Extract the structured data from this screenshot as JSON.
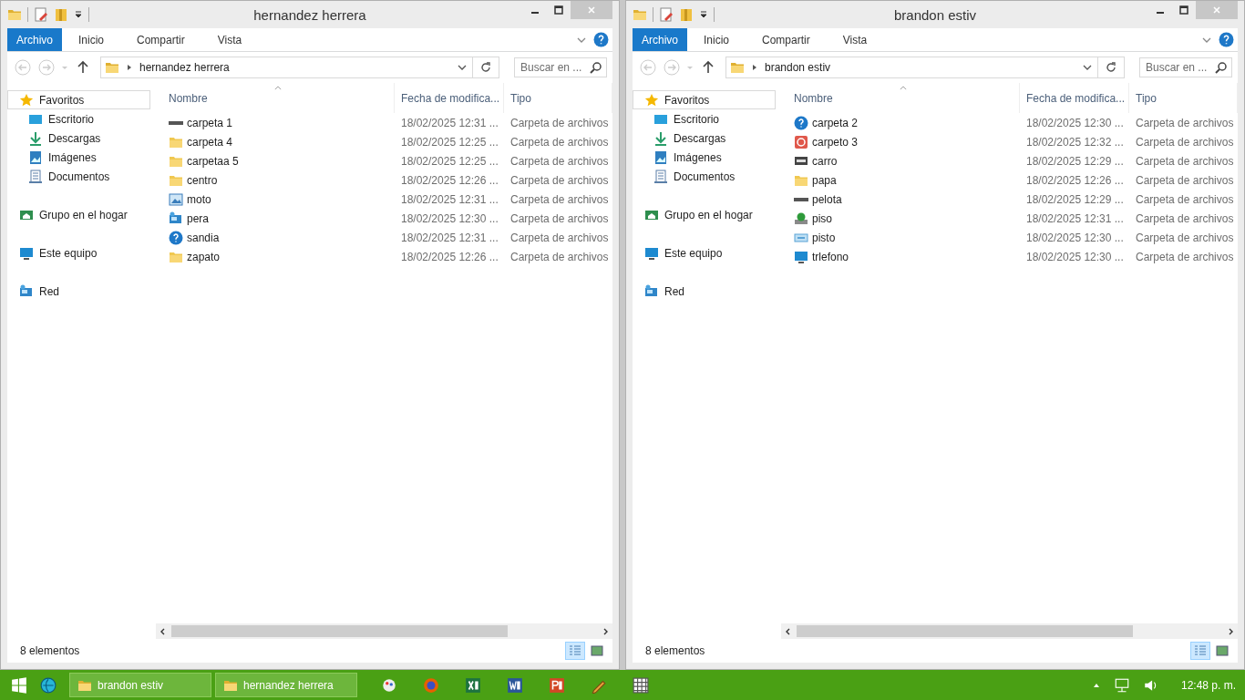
{
  "windows": [
    {
      "title": "hernandez herrera",
      "file_tab": "Archivo",
      "ribbon_tabs": [
        "Inicio",
        "Compartir",
        "Vista"
      ],
      "address": "hernandez herrera",
      "search_placeholder": "Buscar en ...",
      "nav": [
        {
          "label": "Favoritos",
          "kind": "star",
          "selected": true,
          "children": [
            {
              "label": "Escritorio",
              "kind": "desktop",
              "selected": false
            },
            {
              "label": "Descargas",
              "kind": "download",
              "selected": false
            },
            {
              "label": "Imágenes",
              "kind": "pictures",
              "selected": false
            },
            {
              "label": "Documentos",
              "kind": "documents",
              "selected": false
            }
          ]
        },
        {
          "label": "Grupo en el hogar",
          "kind": "homegroup",
          "selected": false
        },
        {
          "label": "Este equipo",
          "kind": "computer",
          "selected": false
        },
        {
          "label": "Red",
          "kind": "network",
          "selected": false
        }
      ],
      "columns": [
        "Nombre",
        "Fecha de modifica...",
        "Tipo"
      ],
      "files": [
        {
          "name": "carpeta 1",
          "kind": "drive",
          "date": "18/02/2025 12:31 ...",
          "type": "Carpeta de archivos"
        },
        {
          "name": "carpeta 4",
          "kind": "folder",
          "date": "18/02/2025 12:25 ...",
          "type": "Carpeta de archivos"
        },
        {
          "name": "carpetaa 5",
          "kind": "folder",
          "date": "18/02/2025 12:25 ...",
          "type": "Carpeta de archivos"
        },
        {
          "name": "centro",
          "kind": "folder",
          "date": "18/02/2025 12:26 ...",
          "type": "Carpeta de archivos"
        },
        {
          "name": "moto",
          "kind": "picture",
          "date": "18/02/2025 12:31 ...",
          "type": "Carpeta de archivos"
        },
        {
          "name": "pera",
          "kind": "network",
          "date": "18/02/2025 12:30 ...",
          "type": "Carpeta de archivos"
        },
        {
          "name": "sandia",
          "kind": "help",
          "date": "18/02/2025 12:31 ...",
          "type": "Carpeta de archivos"
        },
        {
          "name": "zapato",
          "kind": "folder",
          "date": "18/02/2025 12:26 ...",
          "type": "Carpeta de archivos"
        }
      ],
      "status": "8 elementos"
    },
    {
      "title": "brandon estiv",
      "file_tab": "Archivo",
      "ribbon_tabs": [
        "Inicio",
        "Compartir",
        "Vista"
      ],
      "address": "brandon estiv",
      "search_placeholder": "Buscar en ...",
      "nav": [
        {
          "label": "Favoritos",
          "kind": "star",
          "selected": true,
          "children": [
            {
              "label": "Escritorio",
              "kind": "desktop",
              "selected": false
            },
            {
              "label": "Descargas",
              "kind": "download",
              "selected": false
            },
            {
              "label": "Imágenes",
              "kind": "pictures",
              "selected": false
            },
            {
              "label": "Documentos",
              "kind": "documents",
              "selected": false
            }
          ]
        },
        {
          "label": "Grupo en el hogar",
          "kind": "homegroup",
          "selected": false
        },
        {
          "label": "Este equipo",
          "kind": "computer",
          "selected": false
        },
        {
          "label": "Red",
          "kind": "network",
          "selected": false
        }
      ],
      "columns": [
        "Nombre",
        "Fecha de modifica...",
        "Tipo"
      ],
      "files": [
        {
          "name": "carpeta 2",
          "kind": "help",
          "date": "18/02/2025 12:30 ...",
          "type": "Carpeta de archivos"
        },
        {
          "name": "carpeto 3",
          "kind": "media",
          "date": "18/02/2025 12:32 ...",
          "type": "Carpeta de archivos"
        },
        {
          "name": "carro",
          "kind": "printer",
          "date": "18/02/2025 12:29 ...",
          "type": "Carpeta de archivos"
        },
        {
          "name": "papa",
          "kind": "folder",
          "date": "18/02/2025 12:26 ...",
          "type": "Carpeta de archivos"
        },
        {
          "name": "pelota",
          "kind": "drive",
          "date": "18/02/2025 12:29 ...",
          "type": "Carpeta de archivos"
        },
        {
          "name": "piso",
          "kind": "game",
          "date": "18/02/2025 12:31 ...",
          "type": "Carpeta de archivos"
        },
        {
          "name": "pisto",
          "kind": "removable",
          "date": "18/02/2025 12:30 ...",
          "type": "Carpeta de archivos"
        },
        {
          "name": "trlefono",
          "kind": "monitor",
          "date": "18/02/2025 12:30 ...",
          "type": "Carpeta de archivos"
        }
      ],
      "status": "8 elementos"
    }
  ],
  "taskbar": {
    "windows": [
      "brandon estiv",
      "hernandez herrera"
    ],
    "clock": "12:48 p. m."
  }
}
